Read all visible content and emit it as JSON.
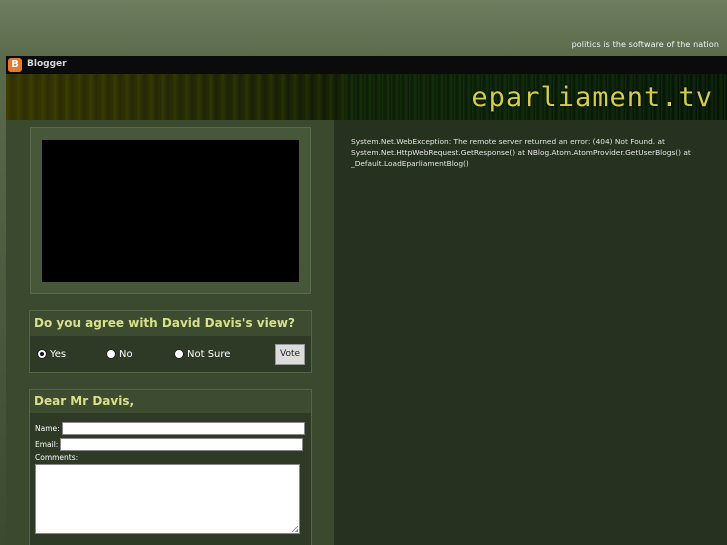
{
  "header": {
    "tagline": "politics is the software of the nation",
    "blogger_label": "Blogger",
    "site_title": "eparliament.tv"
  },
  "error": {
    "message": "System.Net.WebException: The remote server returned an error: (404) Not Found. at System.Net.HttpWebRequest.GetResponse() at NBlog.Atom.AtomProvider.GetUserBlogs() at _Default.LoadEparliamentBlog()"
  },
  "poll": {
    "question": "Do you agree with David Davis's view?",
    "options": [
      {
        "label": "Yes",
        "selected": true
      },
      {
        "label": "No",
        "selected": false
      },
      {
        "label": "Not Sure",
        "selected": false
      }
    ],
    "vote_label": "Vote"
  },
  "letter": {
    "heading": "Dear Mr Davis,",
    "name_label": "Name:",
    "email_label": "Email:",
    "comments_label": "Comments:",
    "name_value": "",
    "email_value": "",
    "comments_value": ""
  },
  "colors": {
    "accent": "#d7e08a",
    "title": "#d4cc4a",
    "panel": "#3b4a2f",
    "content_bg": "#26311f"
  }
}
